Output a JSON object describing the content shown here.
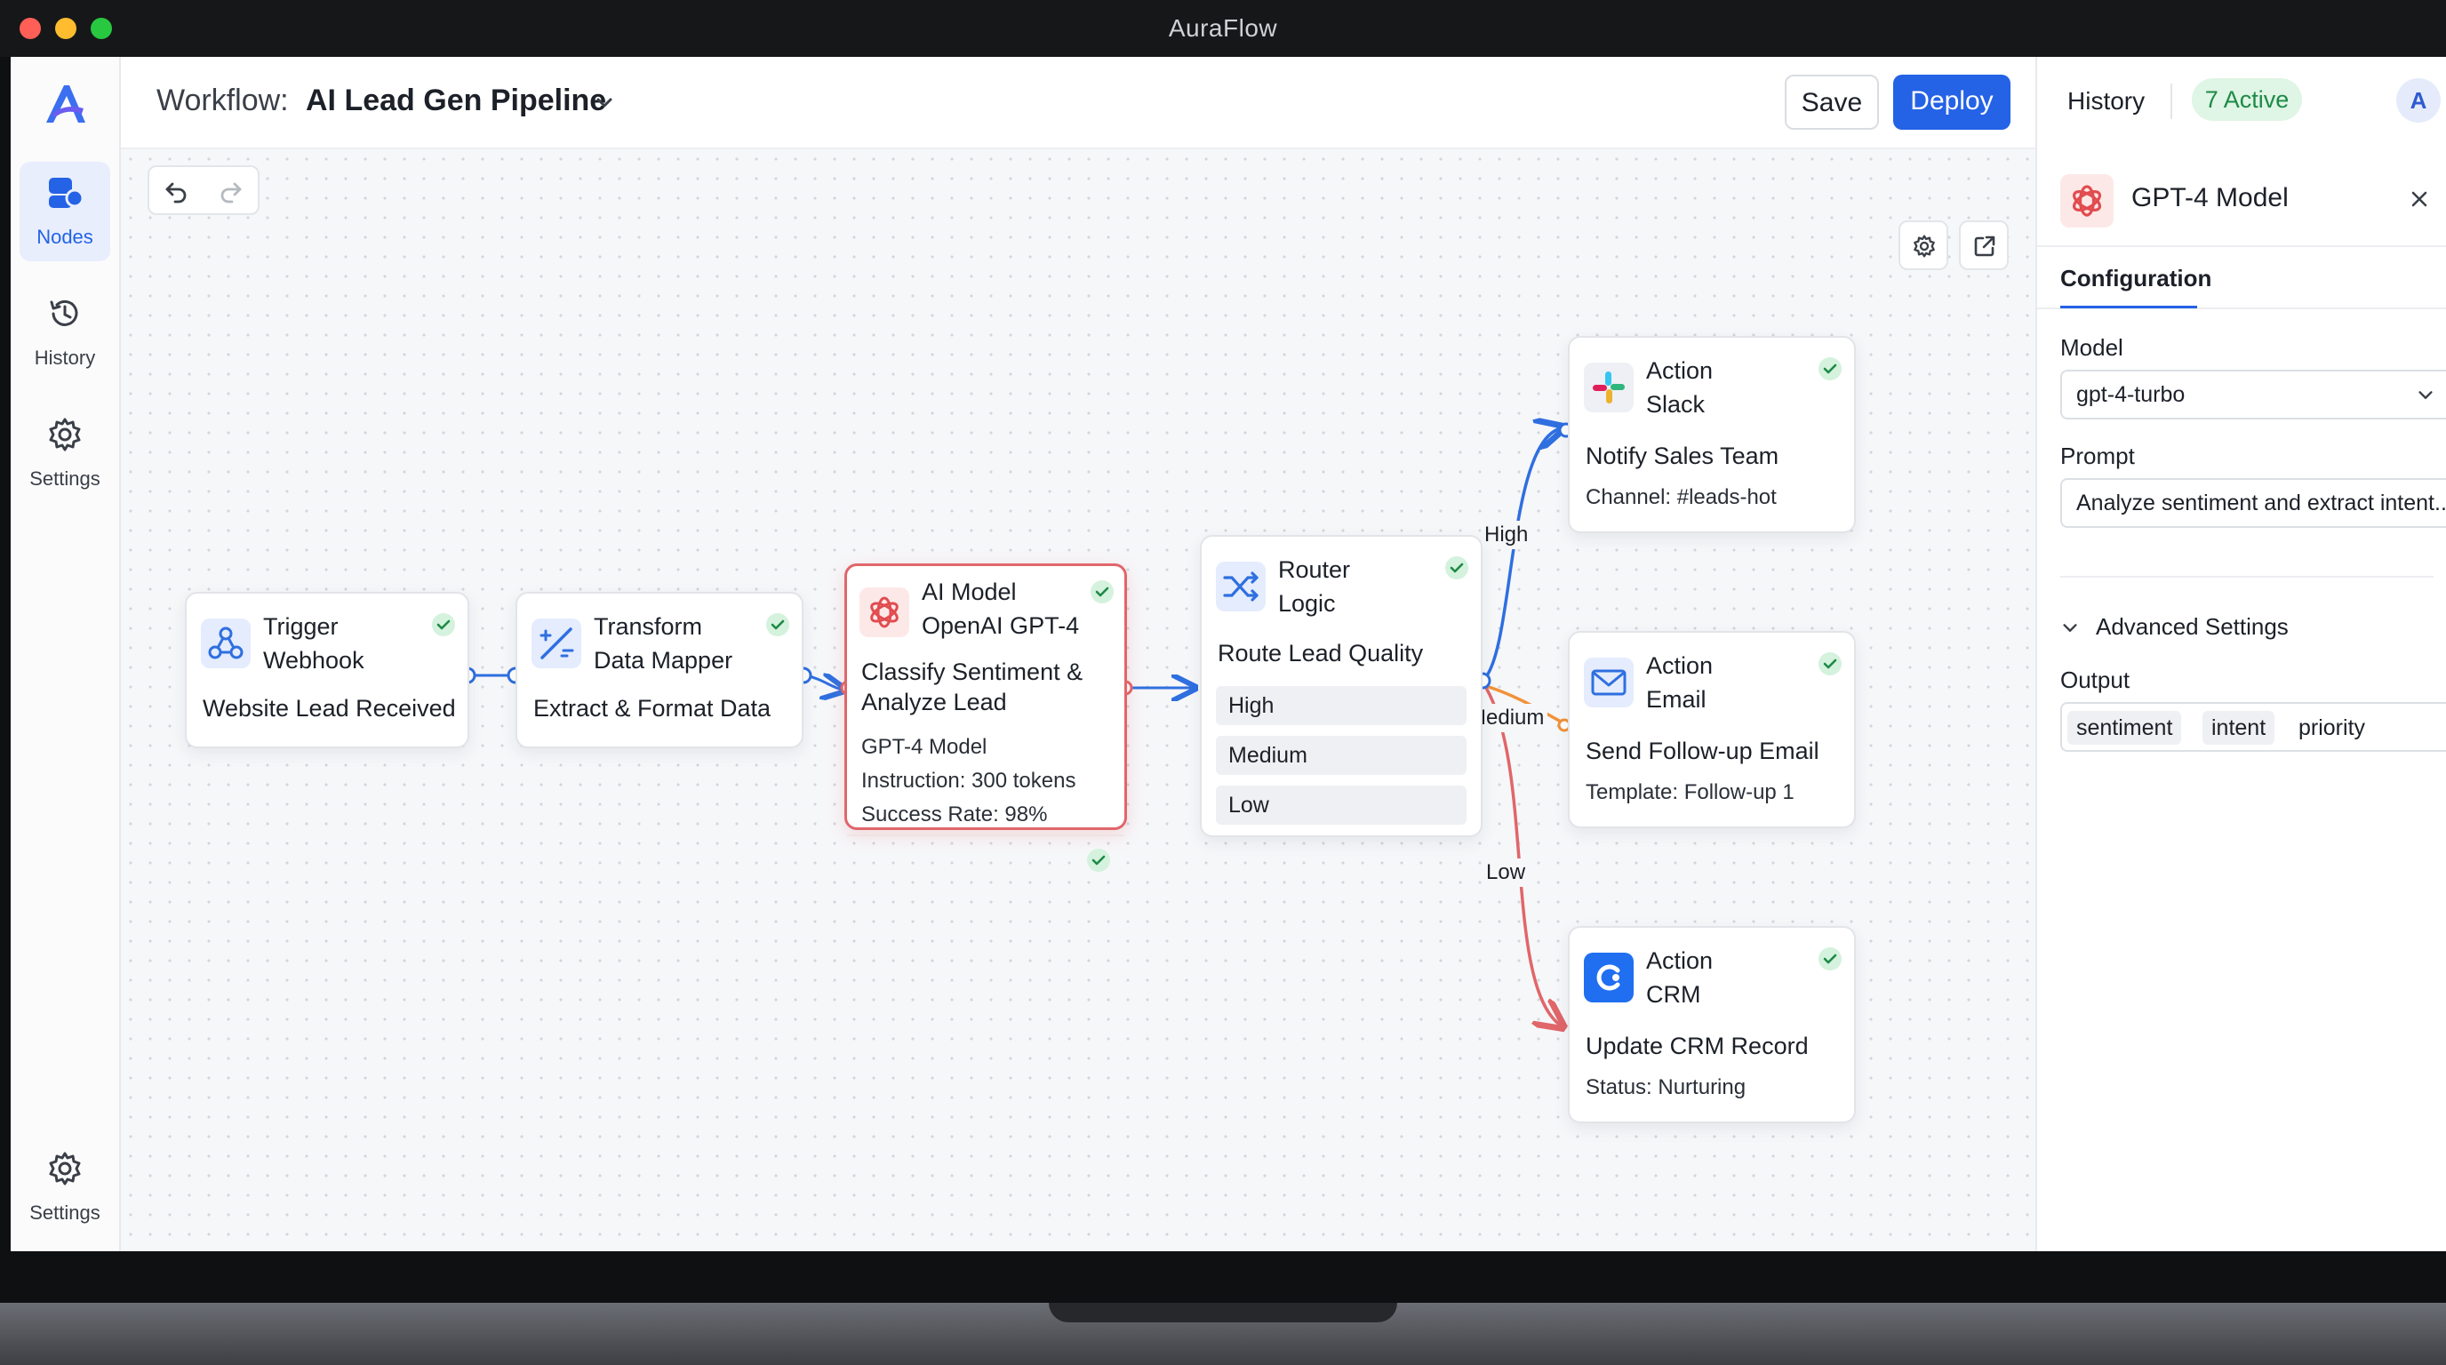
{
  "window": {
    "title": "AuraFlow"
  },
  "sidebar": {
    "items": [
      {
        "label": "Nodes",
        "icon": "nodes-icon",
        "active": true
      },
      {
        "label": "History",
        "icon": "history-icon"
      },
      {
        "label": "Settings",
        "icon": "gear-icon"
      }
    ],
    "bottom": {
      "label": "Settings",
      "icon": "gear-icon"
    }
  },
  "header": {
    "prefix": "Workflow:",
    "workflow_name": "AI Lead Gen Pipeline",
    "save_label": "Save",
    "deploy_label": "Deploy"
  },
  "nodes": {
    "trigger": {
      "type": "Trigger",
      "subtitle": "Webhook",
      "description": "Website Lead Received",
      "status": "success"
    },
    "transform": {
      "type": "Transform",
      "subtitle": "Data Mapper",
      "description": "Extract & Format Data",
      "status": "success"
    },
    "ai_model": {
      "type": "AI Model",
      "subtitle": "OpenAI GPT-4",
      "description_line1": "Classify Sentiment &",
      "description_line2": "Analyze Lead",
      "model": "GPT-4 Model",
      "instruction": "Instruction: 300 tokens",
      "success_rate": "Success Rate: 98%",
      "status": "success",
      "selected": true
    },
    "router": {
      "type": "Router",
      "subtitle": "Logic",
      "description": "Route Lead Quality",
      "routes": [
        "High",
        "Medium",
        "Low"
      ],
      "status": "success"
    },
    "slack": {
      "type": "Action",
      "subtitle": "Slack",
      "description": "Notify Sales Team",
      "detail": "Channel: #leads-hot",
      "status": "success"
    },
    "email": {
      "type": "Action",
      "subtitle": "Email",
      "description": "Send Follow-up Email",
      "detail": "Template: Follow-up 1",
      "status": "success"
    },
    "crm": {
      "type": "Action",
      "subtitle": "CRM",
      "description": "Update CRM Record",
      "detail": "Status: Nurturing",
      "status": "success"
    }
  },
  "edge_labels": {
    "high": "High",
    "medium": "Medium",
    "low": "Low"
  },
  "edge_colors": {
    "default": "#2f6fe0",
    "high": "#2f6fe0",
    "medium": "#f0923a",
    "low": "#e0666a"
  },
  "right_panel": {
    "history_label": "History",
    "active_badge": "7 Active",
    "avatar": "A",
    "node_title": "GPT-4 Model",
    "tab": "Configuration",
    "model_label": "Model",
    "model_value": "gpt-4-turbo",
    "prompt_label": "Prompt",
    "prompt_value": "Analyze sentiment and extract intent...",
    "advanced_label": "Advanced Settings",
    "output_label": "Output",
    "output_tags": [
      "sentiment",
      "intent",
      "priority"
    ]
  },
  "colors": {
    "accent": "#2462e6",
    "success": "#1e8a47",
    "selected_border": "#e0666a",
    "openai_red": "#e14c4f"
  }
}
